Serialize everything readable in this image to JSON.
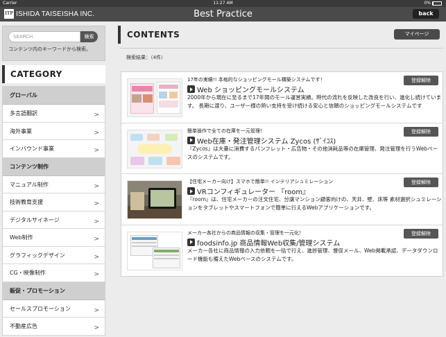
{
  "status_bar": {
    "carrier": "Carrier",
    "time": "11:27 AM",
    "battery": "0%",
    "battery_level": 0.05
  },
  "nav": {
    "logo_mark": "ITP",
    "logo_text": "ISHIDA TAISEISHA INC.",
    "title": "Best Practice",
    "back_label": "back"
  },
  "search": {
    "placeholder": "SEARCH",
    "button_label": "検索",
    "hint": "コンテンツ内のキーワードから検索。"
  },
  "category": {
    "heading": "CATEGORY",
    "groups": [
      {
        "label": "グローバル",
        "items": [
          "多言語翻訳",
          "海外事業",
          "インバウンド事業"
        ]
      },
      {
        "label": "コンテンツ制作",
        "items": [
          "マニュアル制作",
          "技術教育支援",
          "デジタルサイネージ",
          "Web制作",
          "グラフィックデザイン",
          "CG・映像制作"
        ]
      },
      {
        "label": "販促・プロモーション",
        "items": [
          "セールスプロモーション",
          "不動産広告"
        ]
      }
    ]
  },
  "main": {
    "heading": "CONTENTS",
    "mypage_label": "マイページ",
    "result_count": "検索結果：（4件）",
    "unregister_label": "登録解除",
    "items": [
      {
        "catch": "17年の実績!! 本格的なショッピングモール構築システムです！",
        "title": "Web ショッピングモールシステム",
        "desc": "2000年から現在に至るまで17年間のモール運営実績。時代の流れを反映した改良を行い、進化し続けています。 長期に渡り、ユーザー様の熱い支持を受け続ける安心と信頼のショッピングモールシステムです"
      },
      {
        "catch": "簡単操作で全ての在庫を一元管理！",
        "title": "Web在庫・発注管理システム Zycos (ｻﾞｲｺｽ)",
        "desc": "『Zycos』は大量に消費するパンフレット・広告物・その他消耗品等の在庫管理、発注管理を行うWebベースのシステムです。"
      },
      {
        "catch": "【住宅メーカー向け】スマホで簡単!! インテリアシュミレーション",
        "title": "VRコンフィギュレーター 『room』",
        "desc": "『room』は、住宅メーカーの注文住宅、分譲マンション顧客向けの、天井、壁、床等 素材選択シュミレーションをタブレットやスマートフォンで簡単に行えるWebアプリケーションです。"
      },
      {
        "catch": "メーカー各社からの商品情報の収集・管理を一元化！",
        "title": "foodsinfo.jp 商品情報Web収集/管理システム",
        "desc": "メーカー各社に商品情報の入力依頼を一括で行え、進捗管理、督促メール、Web掲載承認、データダウンロード機能も備えたWebベースのシステムです。"
      }
    ]
  },
  "icons": {
    "play": "play-icon",
    "chevron": "chevron-right-icon"
  }
}
